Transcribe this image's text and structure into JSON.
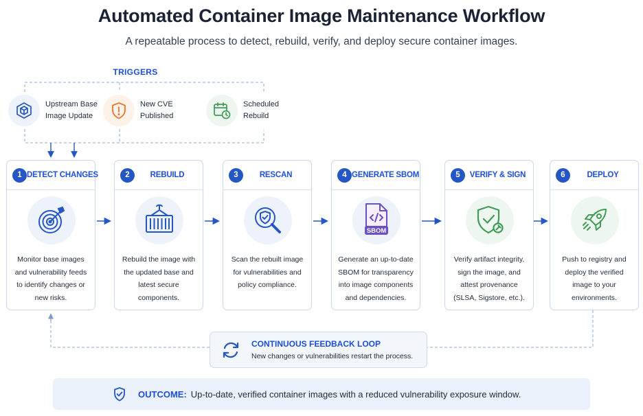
{
  "header": {
    "title": "Automated Container Image Maintenance Workflow",
    "subtitle": "A repeatable process to detect, rebuild, verify, and deploy secure container images."
  },
  "triggers": {
    "label": "TRIGGERS",
    "items": [
      {
        "label": "Upstream Base Image Update",
        "icon": "cube-icon",
        "color": "#1d4ed8"
      },
      {
        "label": "New CVE Published",
        "icon": "warning-shield-icon",
        "color": "#e8772e"
      },
      {
        "label": "Scheduled Rebuild",
        "icon": "calendar-clock-icon",
        "color": "#3f9b57"
      }
    ]
  },
  "steps": [
    {
      "number": "1",
      "title": "DETECT CHANGES",
      "icon": "target-icon",
      "description": "Monitor base images and vulnerability feeds to identify changes or new risks."
    },
    {
      "number": "2",
      "title": "REBUILD",
      "icon": "container-icon",
      "description": "Rebuild the image with the updated base and latest secure components."
    },
    {
      "number": "3",
      "title": "RESCAN",
      "icon": "magnifier-shield-icon",
      "description": "Scan the rebuilt image for vulnerabilities and policy compliance."
    },
    {
      "number": "4",
      "title": "GENERATE SBOM",
      "icon": "sbom-document-icon",
      "icon_label": "SBOM",
      "description": "Generate an up-to-date SBOM for transparency into image components and dependencies."
    },
    {
      "number": "5",
      "title": "VERIFY & SIGN",
      "icon": "shield-check-icon",
      "description": "Verify artifact integrity, sign the image, and attest provenance (SLSA, Sigstore, etc.)."
    },
    {
      "number": "6",
      "title": "DEPLOY",
      "icon": "rocket-icon",
      "description": "Push to registry and deploy the verified image to your environments."
    }
  ],
  "feedback": {
    "title": "CONTINUOUS FEEDBACK LOOP",
    "description": "New changes or vulnerabilities restart the process.",
    "icon": "refresh-icon"
  },
  "outcome": {
    "label": "OUTCOME:",
    "text": "Up-to-date, verified container images with a reduced vulnerability exposure window.",
    "icon": "shield-check-icon"
  },
  "colors": {
    "accent": "#1d4ed8",
    "number_badge": "#2456c4",
    "warning": "#e8772e",
    "success": "#3f9b57",
    "connector": "#8aa8d8"
  }
}
